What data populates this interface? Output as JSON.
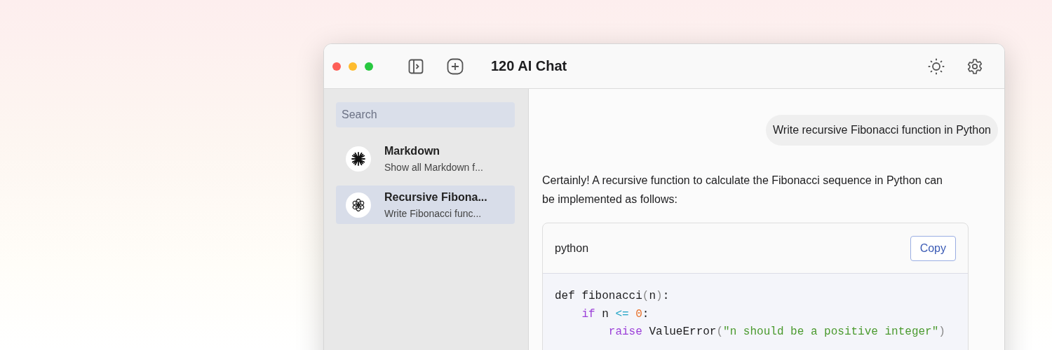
{
  "window": {
    "title": "120 AI Chat"
  },
  "sidebar": {
    "search": {
      "placeholder": "Search"
    },
    "conversations": [
      {
        "kind": "starburst",
        "title": "Markdown",
        "preview": "Show all Markdown f...",
        "selected": false
      },
      {
        "kind": "knot",
        "title": "Recursive Fibona...",
        "preview": "Write Fibonacci func...",
        "selected": true
      }
    ]
  },
  "chat": {
    "user_message": "Write recursive Fibonacci function in Python",
    "assistant_message": "Certainly! A recursive function to calculate the Fibonacci sequence in Python can be implemented as follows:",
    "code_block": {
      "language": "python",
      "copy_label": "Copy",
      "lines": [
        [
          {
            "text": "def fibonacci",
            "kind": "plain"
          },
          {
            "text": "(",
            "kind": "punct"
          },
          {
            "text": "n",
            "kind": "plain"
          },
          {
            "text": ")",
            "kind": "punct"
          },
          {
            "text": ":",
            "kind": "plain"
          }
        ],
        [
          {
            "text": "    if",
            "kind": "keyword"
          },
          {
            "text": " n ",
            "kind": "plain"
          },
          {
            "text": "<=",
            "kind": "operator"
          },
          {
            "text": " 0",
            "kind": "number"
          },
          {
            "text": ":",
            "kind": "plain"
          }
        ],
        [
          {
            "text": "        raise",
            "kind": "keyword"
          },
          {
            "text": " ValueError",
            "kind": "plain"
          },
          {
            "text": "(",
            "kind": "punct"
          },
          {
            "text": "\"n should be a positive integer\"",
            "kind": "string"
          },
          {
            "text": ")",
            "kind": "punct"
          }
        ]
      ]
    }
  }
}
